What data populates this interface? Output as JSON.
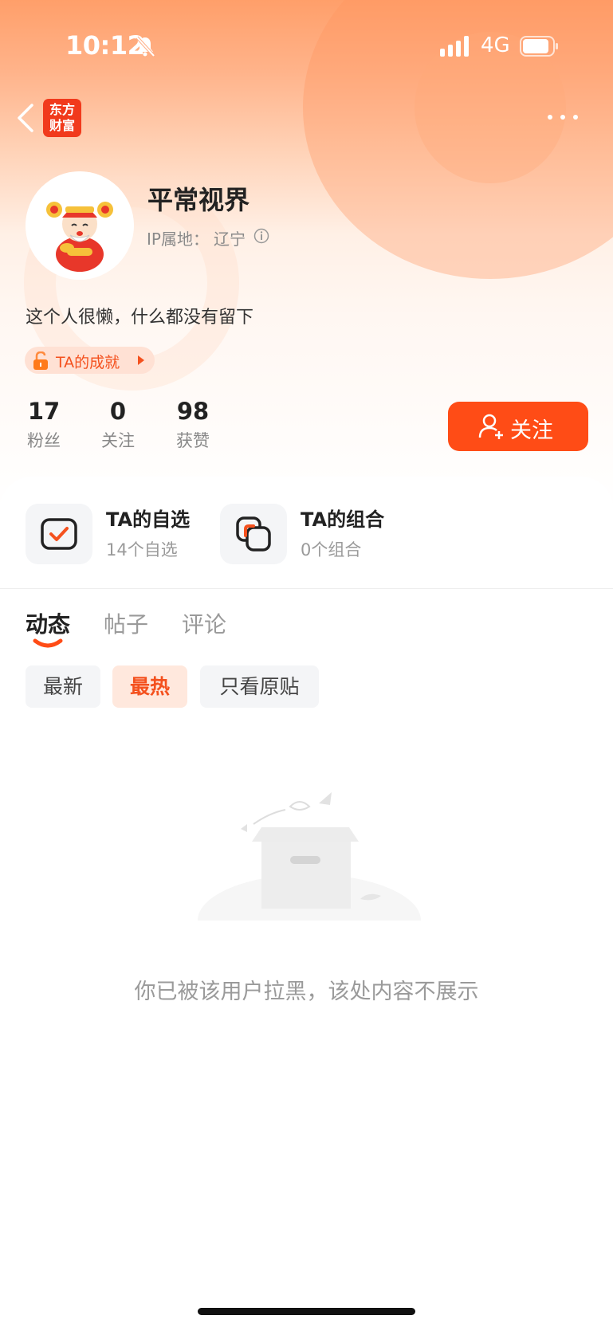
{
  "status_bar": {
    "time": "10:12",
    "network": "4G"
  },
  "header": {
    "logo_text_line1": "东方",
    "logo_text_line2": "财富"
  },
  "profile": {
    "username": "平常视界",
    "ip_label": "IP属地：",
    "ip_value": "辽宁",
    "bio": "这个人很懒，什么都没有留下",
    "achievement_label": "TA的成就"
  },
  "stats": [
    {
      "value": "17",
      "label": "粉丝"
    },
    {
      "value": "0",
      "label": "关注"
    },
    {
      "value": "98",
      "label": "获赞"
    }
  ],
  "follow_button": {
    "label": "关注"
  },
  "entries": [
    {
      "title": "TA的自选",
      "subtitle": "14个自选",
      "icon": "checkbox-icon"
    },
    {
      "title": "TA的组合",
      "subtitle": "0个组合",
      "icon": "portfolio-icon"
    }
  ],
  "tabs": [
    {
      "label": "动态",
      "active": true
    },
    {
      "label": "帖子",
      "active": false
    },
    {
      "label": "评论",
      "active": false
    }
  ],
  "filters": [
    {
      "label": "最新",
      "active": false
    },
    {
      "label": "最热",
      "active": true
    },
    {
      "label": "只看原贴",
      "active": false
    }
  ],
  "empty_state": {
    "message": "你已被该用户拉黑，该处内容不展示",
    "icon": "empty-box-icon"
  },
  "colors": {
    "accent": "#ff4c16",
    "brand_red": "#f13a1c",
    "muted_text": "#9a9a9a"
  }
}
